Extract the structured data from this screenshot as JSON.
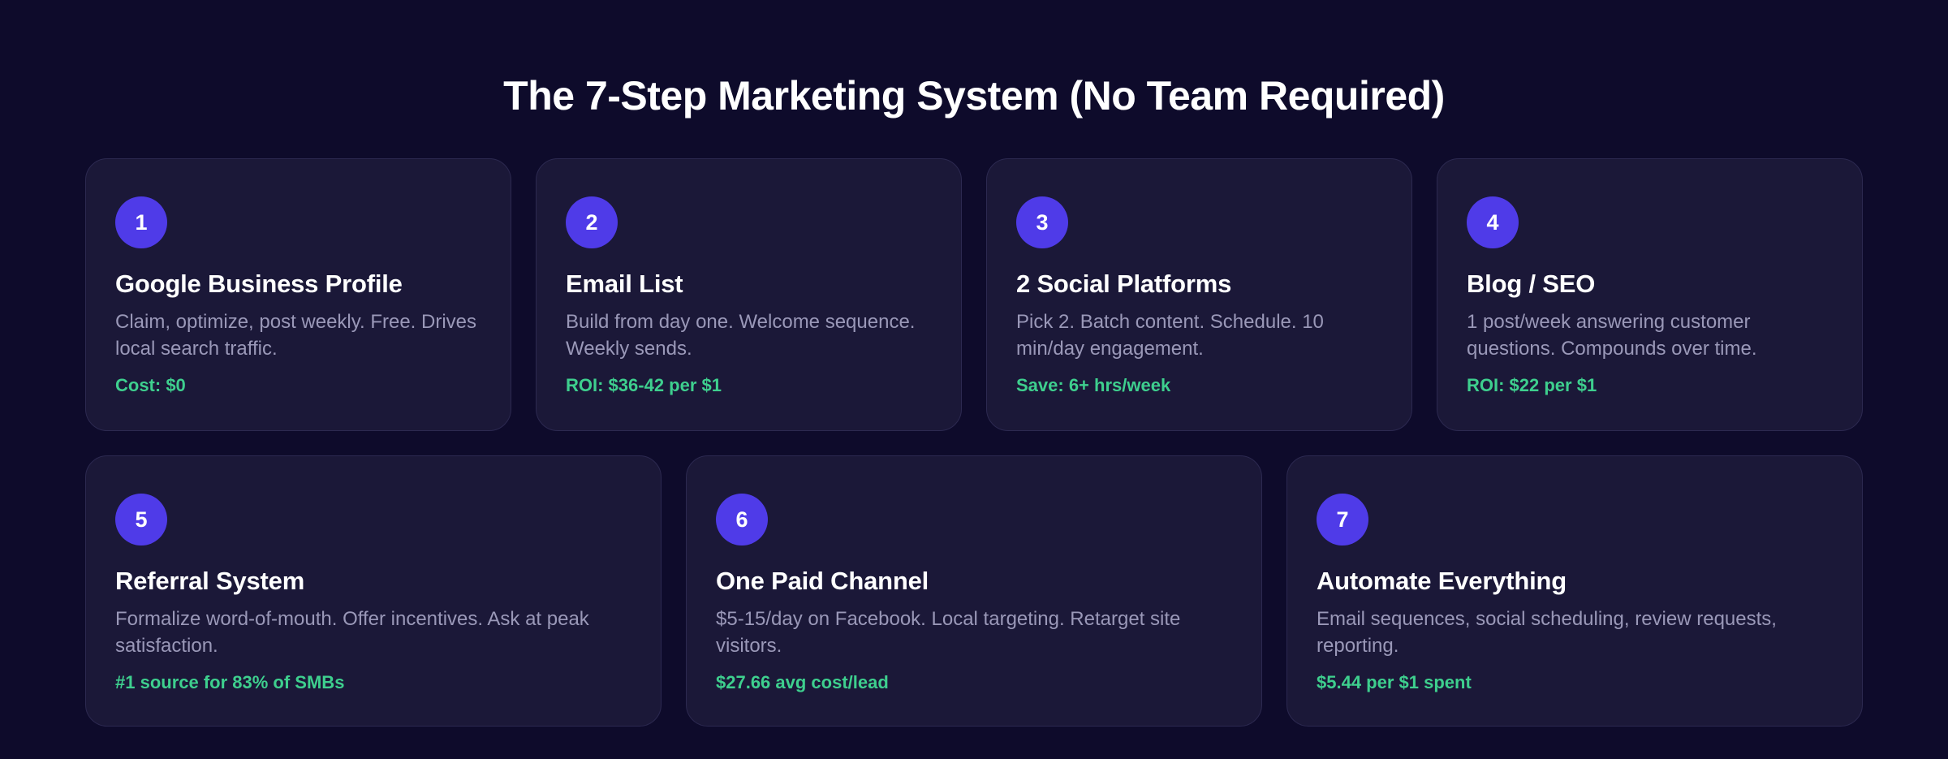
{
  "header": {
    "title": "The 7-Step Marketing System (No Team Required)"
  },
  "colors": {
    "background": "#0e0b2b",
    "card": "#1b1838",
    "badge": "#4f3be8",
    "metric": "#3ecf8e",
    "description": "#9a98b8"
  },
  "steps": [
    {
      "number": "1",
      "title": "Google Business Profile",
      "description": "Claim, optimize, post weekly. Free. Drives local search traffic.",
      "metric": "Cost: $0"
    },
    {
      "number": "2",
      "title": "Email List",
      "description": "Build from day one. Welcome sequence. Weekly sends.",
      "metric": "ROI: $36-42 per $1"
    },
    {
      "number": "3",
      "title": "2 Social Platforms",
      "description": "Pick 2. Batch content. Schedule. 10 min/day engagement.",
      "metric": "Save: 6+ hrs/week"
    },
    {
      "number": "4",
      "title": "Blog / SEO",
      "description": "1 post/week answering customer questions. Compounds over time.",
      "metric": "ROI: $22 per $1"
    },
    {
      "number": "5",
      "title": "Referral System",
      "description": "Formalize word-of-mouth. Offer incentives. Ask at peak satisfaction.",
      "metric": "#1 source for 83% of SMBs"
    },
    {
      "number": "6",
      "title": "One Paid Channel",
      "description": "$5-15/day on Facebook. Local targeting. Retarget site visitors.",
      "metric": "$27.66 avg cost/lead"
    },
    {
      "number": "7",
      "title": "Automate Everything",
      "description": "Email sequences, social scheduling, review requests, reporting.",
      "metric": "$5.44 per $1 spent"
    }
  ]
}
